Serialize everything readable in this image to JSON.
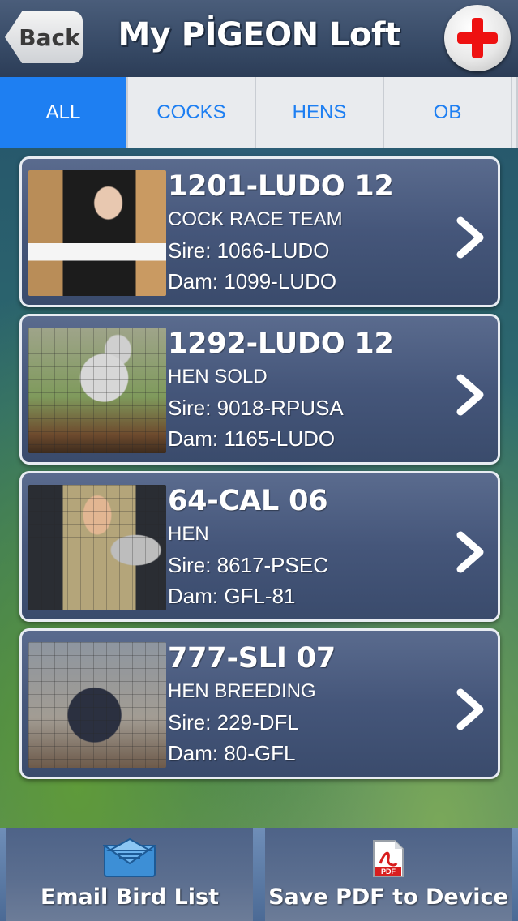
{
  "header": {
    "back_label": "Back",
    "title": "My PİGEON Loft",
    "add_icon": "plus-icon"
  },
  "tabs": [
    {
      "label": "ALL",
      "active": true
    },
    {
      "label": "COCKS",
      "active": false
    },
    {
      "label": "HENS",
      "active": false
    },
    {
      "label": "OB",
      "active": false
    }
  ],
  "birds": [
    {
      "id": "1201-LUDO 12",
      "note": "COCK RACE TEAM",
      "sire": "Sire: 1066-LUDO",
      "dam": "Dam: 1099-LUDO"
    },
    {
      "id": "1292-LUDO 12",
      "note": "HEN SOLD",
      "sire": "Sire: 9018-RPUSA",
      "dam": "Dam: 1165-LUDO"
    },
    {
      "id": "64-CAL 06",
      "note": "HEN",
      "sire": "Sire: 8617-PSEC",
      "dam": "Dam: GFL-81"
    },
    {
      "id": "777-SLI 07",
      "note": "HEN BREEDING",
      "sire": "Sire: 229-DFL",
      "dam": "Dam: 80-GFL"
    }
  ],
  "toolbar": {
    "email_label": "Email Bird List",
    "pdf_label": "Save PDF to Device",
    "pdf_icon_text": "PDF"
  },
  "colors": {
    "accent": "#1e7ff2",
    "add_plus": "#ee1111",
    "card_bg": "#45567a"
  }
}
